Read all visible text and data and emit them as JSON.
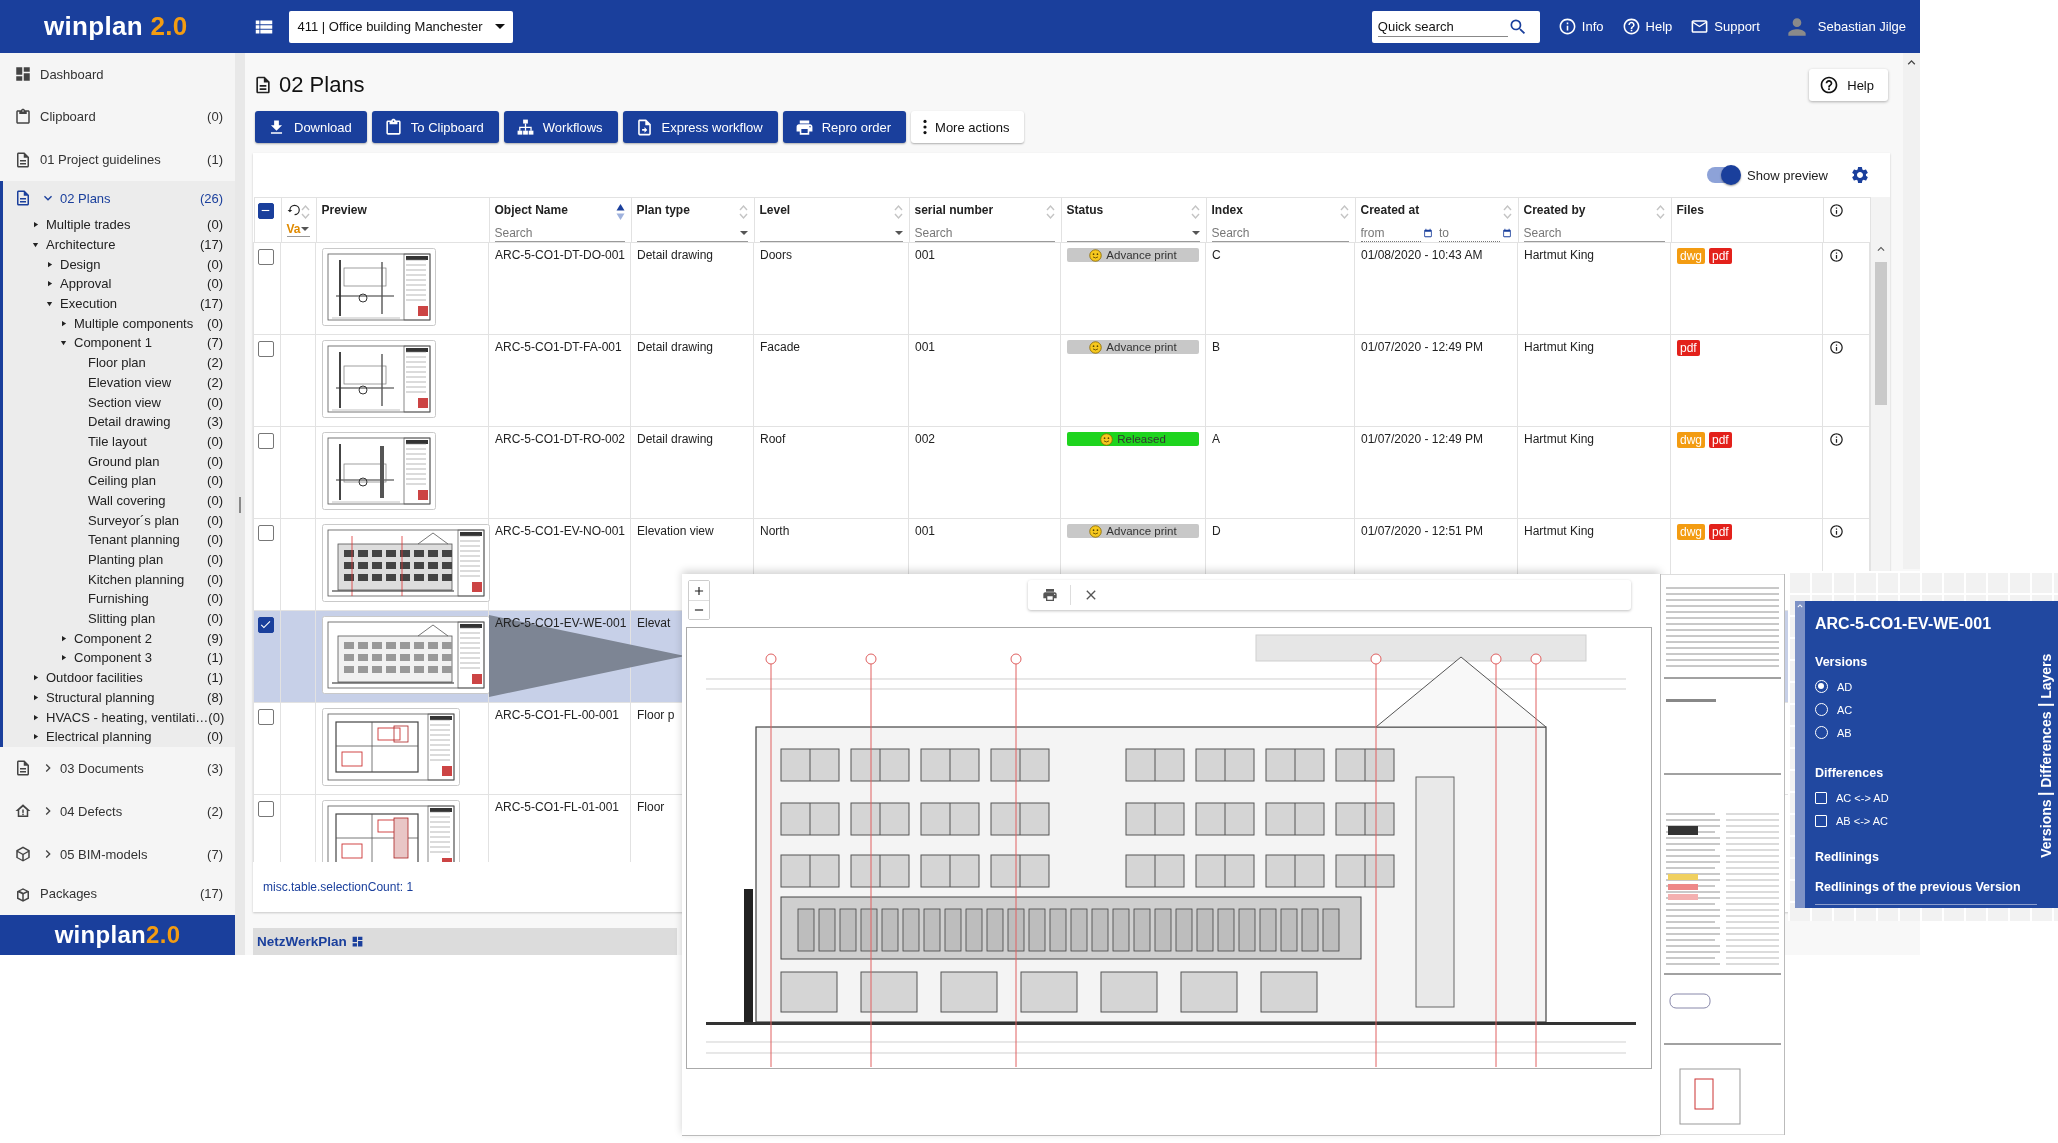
{
  "header": {
    "logo": {
      "name": "winplan",
      "version": "2.0"
    },
    "project_select": {
      "value": "411 | Office building Manchester"
    },
    "quick_search": {
      "placeholder": "Quick search"
    },
    "links": [
      {
        "label": "Info",
        "kind": "info"
      },
      {
        "label": "Help",
        "kind": "help"
      },
      {
        "label": "Support",
        "kind": "mail"
      }
    ],
    "user": {
      "name": "Sebastian Jilge"
    }
  },
  "sidebar": {
    "items": [
      {
        "label": "Dashboard",
        "kind": "dashboard",
        "selected": false
      },
      {
        "label": "Clipboard",
        "count": "(0)",
        "kind": "clipboard",
        "selected": false
      },
      {
        "label": "01 Project guidelines",
        "count": "(1)",
        "kind": "document",
        "selected": false
      },
      {
        "label": "02 Plans",
        "count": "(26)",
        "kind": "document",
        "selected": true,
        "expanded": true,
        "children": [
          {
            "label": "Multiple trades",
            "count": "(0)",
            "expanded": false
          },
          {
            "label": "Architecture",
            "count": "(17)",
            "expanded": true,
            "children": [
              {
                "label": "Design",
                "count": "(0)",
                "expanded": false
              },
              {
                "label": "Approval",
                "count": "(0)",
                "expanded": false
              },
              {
                "label": "Execution",
                "count": "(17)",
                "expanded": true,
                "children": [
                  {
                    "label": "Multiple components",
                    "count": "(0)",
                    "expanded": false
                  },
                  {
                    "label": "Component 1",
                    "count": "(7)",
                    "expanded": true,
                    "children": [
                      {
                        "label": "Floor plan",
                        "count": "(2)"
                      },
                      {
                        "label": "Elevation view",
                        "count": "(2)"
                      },
                      {
                        "label": "Section view",
                        "count": "(0)"
                      },
                      {
                        "label": "Detail drawing",
                        "count": "(3)"
                      },
                      {
                        "label": "Tile layout",
                        "count": "(0)"
                      },
                      {
                        "label": "Ground plan",
                        "count": "(0)"
                      },
                      {
                        "label": "Ceiling plan",
                        "count": "(0)"
                      },
                      {
                        "label": "Wall covering",
                        "count": "(0)"
                      },
                      {
                        "label": "Surveyor´s plan",
                        "count": "(0)"
                      },
                      {
                        "label": "Tenant planning",
                        "count": "(0)"
                      },
                      {
                        "label": "Planting plan",
                        "count": "(0)"
                      },
                      {
                        "label": "Kitchen planning",
                        "count": "(0)"
                      },
                      {
                        "label": "Furnishing",
                        "count": "(0)"
                      },
                      {
                        "label": "Slitting plan",
                        "count": "(0)"
                      }
                    ]
                  },
                  {
                    "label": "Component 2",
                    "count": "(9)",
                    "expanded": false
                  },
                  {
                    "label": "Component 3",
                    "count": "(1)",
                    "expanded": false
                  }
                ]
              }
            ]
          },
          {
            "label": "Outdoor facilities",
            "count": "(1)",
            "expanded": false
          },
          {
            "label": "Structural planning",
            "count": "(8)",
            "expanded": false
          },
          {
            "label": "HVACS - heating, ventilati…",
            "count": "(0)",
            "expanded": false
          },
          {
            "label": "Electrical planning",
            "count": "(0)",
            "expanded": false
          }
        ]
      },
      {
        "label": "03 Documents",
        "count": "(3)",
        "kind": "document",
        "selected": false,
        "expanded": false
      },
      {
        "label": "04 Defects",
        "count": "(2)",
        "kind": "defects",
        "selected": false,
        "expanded": false
      },
      {
        "label": "05 BIM-models",
        "count": "(7)",
        "kind": "model",
        "selected": false,
        "expanded": false
      },
      {
        "label": "Packages",
        "count": "(17)",
        "kind": "package",
        "selected": false
      }
    ],
    "logo": {
      "name": "winplan",
      "version": "2.0"
    }
  },
  "page": {
    "title": "02 Plans",
    "help_button": "Help",
    "actions": [
      {
        "label": "Download",
        "kind": "download"
      },
      {
        "label": "To Clipboard",
        "kind": "clipboard"
      },
      {
        "label": "Workflows",
        "kind": "workflow"
      },
      {
        "label": "Express workflow",
        "kind": "express"
      },
      {
        "label": "Repro order",
        "kind": "print"
      },
      {
        "label": "More actions",
        "kind": "more"
      }
    ]
  },
  "table": {
    "show_preview": {
      "label": "Show preview",
      "on": true
    },
    "select_all": {
      "indeterminate": true
    },
    "columns": [
      {
        "kind": "variant",
        "label": "Va",
        "sorted": false
      },
      {
        "kind": "preview",
        "label": "Preview"
      },
      {
        "kind": "data",
        "label": "Object Name",
        "sorted": true,
        "filter": {
          "kind": "search",
          "placeholder": "Search"
        }
      },
      {
        "kind": "data",
        "label": "Plan type",
        "sorted": false,
        "filter": {
          "kind": "select"
        }
      },
      {
        "kind": "data",
        "label": "Level",
        "sorted": false,
        "filter": {
          "kind": "select"
        }
      },
      {
        "kind": "data",
        "label": "serial number",
        "sorted": false,
        "filter": {
          "kind": "search",
          "placeholder": "Search"
        }
      },
      {
        "kind": "data",
        "label": "Status",
        "sorted": false,
        "filter": {
          "kind": "select"
        }
      },
      {
        "kind": "data",
        "label": "Index",
        "sorted": false,
        "filter": {
          "kind": "search",
          "placeholder": "Search"
        }
      },
      {
        "kind": "data",
        "label": "Created at",
        "sorted": false,
        "filter": {
          "kind": "date_range",
          "fields": [
            {
              "placeholder": "from"
            },
            {
              "placeholder": "to"
            }
          ]
        }
      },
      {
        "kind": "data",
        "label": "Created by",
        "sorted": false,
        "filter": {
          "kind": "search",
          "placeholder": "Search"
        }
      },
      {
        "kind": "data",
        "label": "Files"
      },
      {
        "kind": "info"
      }
    ],
    "rows": [
      {
        "selected": false,
        "name": "ARC-5-CO1-DT-DO-001",
        "plan_type": "Detail drawing",
        "level": "Doors",
        "serial_number": "001",
        "status": {
          "label": "Advance print",
          "color": "#c8c8c8"
        },
        "index": "C",
        "created_at": "01/08/2020 - 10:43 AM",
        "created_by": "Hartmut King",
        "files": [
          {
            "label": "dwg",
            "color": "#f39c12"
          },
          {
            "label": "pdf",
            "color": "#e3211b"
          }
        ]
      },
      {
        "selected": false,
        "name": "ARC-5-CO1-DT-FA-001",
        "plan_type": "Detail drawing",
        "level": "Facade",
        "serial_number": "001",
        "status": {
          "label": "Advance print",
          "color": "#c8c8c8"
        },
        "index": "B",
        "created_at": "01/07/2020 - 12:49 PM",
        "created_by": "Hartmut King",
        "files": [
          {
            "label": "pdf",
            "color": "#e3211b"
          }
        ]
      },
      {
        "selected": false,
        "name": "ARC-5-CO1-DT-RO-002",
        "plan_type": "Detail drawing",
        "level": "Roof",
        "serial_number": "002",
        "status": {
          "label": "Released",
          "color": "#1ed41e"
        },
        "index": "A",
        "created_at": "01/07/2020 - 12:49 PM",
        "created_by": "Hartmut King",
        "files": [
          {
            "label": "dwg",
            "color": "#f39c12"
          },
          {
            "label": "pdf",
            "color": "#e3211b"
          }
        ]
      },
      {
        "selected": false,
        "name": "ARC-5-CO1-EV-NO-001",
        "plan_type": "Elevation view",
        "level": "North",
        "serial_number": "001",
        "status": {
          "label": "Advance print",
          "color": "#c8c8c8"
        },
        "index": "D",
        "created_at": "01/07/2020 - 12:51 PM",
        "created_by": "Hartmut King",
        "files": [
          {
            "label": "dwg",
            "color": "#f39c12"
          },
          {
            "label": "pdf",
            "color": "#e3211b"
          }
        ]
      },
      {
        "selected": true,
        "name": "ARC-5-CO1-EV-WE-001",
        "plan_type": "Elevat"
      },
      {
        "selected": false,
        "name": "ARC-5-CO1-FL-00-001",
        "plan_type": "Floor p"
      },
      {
        "selected": false,
        "name": "ARC-5-CO1-FL-01-001",
        "plan_type": "Floor"
      }
    ],
    "selection_count": "misc.table.selectionCount: 1"
  },
  "footer": {
    "label": "NetzWerkPlan"
  },
  "viewer_panel": {
    "title": "ARC-5-CO1-EV-WE-001",
    "versions": {
      "heading": "Versions",
      "options": [
        {
          "label": "AD",
          "selected": true
        },
        {
          "label": "AC",
          "selected": false
        },
        {
          "label": "AB",
          "selected": false
        }
      ]
    },
    "differences": {
      "heading": "Differences",
      "options": [
        {
          "label": "AC <-> AD",
          "checked": false
        },
        {
          "label": "AB <-> AC",
          "checked": false
        }
      ]
    },
    "redlinings": "Redlinings",
    "previous_redlinings": "Redlinings of the previous Version",
    "tabs": [
      "Versions",
      "Differences",
      "Layers"
    ]
  }
}
